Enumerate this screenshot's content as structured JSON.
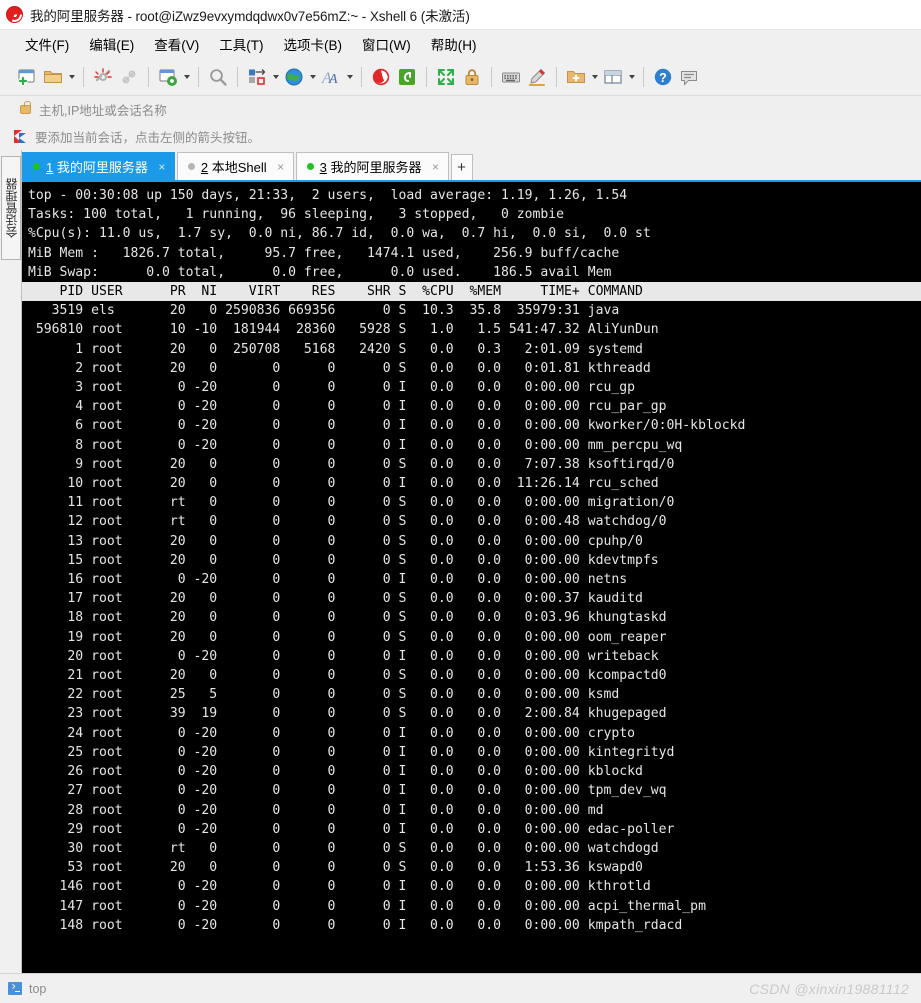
{
  "window": {
    "app_icon": "xshell-logo-icon",
    "title": "我的阿里服务器 - root@iZwz9evxymdqdwx0v7e56mZ:~ - Xshell 6 (未激活)"
  },
  "menubar": {
    "items": [
      {
        "label": "文件(F)",
        "name": "menu-file"
      },
      {
        "label": "编辑(E)",
        "name": "menu-edit"
      },
      {
        "label": "查看(V)",
        "name": "menu-view"
      },
      {
        "label": "工具(T)",
        "name": "menu-tools"
      },
      {
        "label": "选项卡(B)",
        "name": "menu-tabs"
      },
      {
        "label": "窗口(W)",
        "name": "menu-window"
      },
      {
        "label": "帮助(H)",
        "name": "menu-help"
      }
    ]
  },
  "toolbar": {
    "buttons": [
      {
        "icon": "new-session-icon",
        "caret": false
      },
      {
        "icon": "open-folder-icon",
        "caret": true
      },
      {
        "sep": true
      },
      {
        "icon": "disconnect-icon",
        "caret": false
      },
      {
        "icon": "reconnect-icon",
        "caret": false
      },
      {
        "sep": true
      },
      {
        "icon": "session-properties-icon",
        "caret": true
      },
      {
        "sep": true
      },
      {
        "icon": "find-icon",
        "caret": false
      },
      {
        "sep": true
      },
      {
        "icon": "transfer-icon",
        "caret": true
      },
      {
        "icon": "globe-icon",
        "caret": true
      },
      {
        "icon": "font-icon",
        "caret": true
      },
      {
        "sep": true
      },
      {
        "icon": "xshell-red-icon",
        "caret": false
      },
      {
        "icon": "xftp-green-icon",
        "caret": false
      },
      {
        "sep": true
      },
      {
        "icon": "fullscreen-icon",
        "caret": false
      },
      {
        "icon": "lock-icon",
        "caret": false
      },
      {
        "sep": true
      },
      {
        "icon": "keyboard-icon",
        "caret": false
      },
      {
        "icon": "highlight-pen-icon",
        "caret": false
      },
      {
        "sep": true
      },
      {
        "icon": "add-folder-icon",
        "caret": true
      },
      {
        "icon": "split-layout-icon",
        "caret": true
      },
      {
        "sep": true
      },
      {
        "icon": "help-icon",
        "caret": false
      },
      {
        "icon": "chat-icon",
        "caret": false
      }
    ]
  },
  "address": {
    "icon": "lock-icon",
    "placeholder": "主机,IP地址或会话名称",
    "value": ""
  },
  "hint": {
    "icon": "red-flag-icon",
    "text": "要添加当前会话，点击左侧的箭头按钮。"
  },
  "sidebar": {
    "items": [
      {
        "label": "会话管理器",
        "name": "sidebar-session-manager"
      }
    ]
  },
  "tabs": {
    "items": [
      {
        "num": "1",
        "label": "我的阿里服务器",
        "state": "connected",
        "active": true,
        "close": "×"
      },
      {
        "num": "2",
        "label": "本地Shell",
        "state": "idle",
        "active": false,
        "close": "×"
      },
      {
        "num": "3",
        "label": "我的阿里服务器",
        "state": "connected",
        "active": false,
        "close": "×"
      }
    ],
    "add_label": "+"
  },
  "terminal": {
    "summary_lines": [
      "top - 00:30:08 up 150 days, 21:33,  2 users,  load average: 1.19, 1.26, 1.54",
      "Tasks: 100 total,   1 running,  96 sleeping,   3 stopped,   0 zombie",
      "%Cpu(s): 11.0 us,  1.7 sy,  0.0 ni, 86.7 id,  0.0 wa,  0.7 hi,  0.0 si,  0.0 st",
      "MiB Mem :   1826.7 total,     95.7 free,   1474.1 used,    256.9 buff/cache",
      "MiB Swap:      0.0 total,      0.0 free,      0.0 used.    186.5 avail Mem"
    ],
    "blank_line": "",
    "header": "    PID USER      PR  NI    VIRT    RES    SHR S  %CPU  %MEM     TIME+ COMMAND",
    "rows": [
      "   3519 els       20   0 2590836 669356      0 S  10.3  35.8  35979:31 java",
      " 596810 root      10 -10  181944  28360   5928 S   1.0   1.5 541:47.32 AliYunDun",
      "      1 root      20   0  250708   5168   2420 S   0.0   0.3   2:01.09 systemd",
      "      2 root      20   0       0      0      0 S   0.0   0.0   0:01.81 kthreadd",
      "      3 root       0 -20       0      0      0 I   0.0   0.0   0:00.00 rcu_gp",
      "      4 root       0 -20       0      0      0 I   0.0   0.0   0:00.00 rcu_par_gp",
      "      6 root       0 -20       0      0      0 I   0.0   0.0   0:00.00 kworker/0:0H-kblockd",
      "      8 root       0 -20       0      0      0 I   0.0   0.0   0:00.00 mm_percpu_wq",
      "      9 root      20   0       0      0      0 S   0.0   0.0   7:07.38 ksoftirqd/0",
      "     10 root      20   0       0      0      0 I   0.0   0.0  11:26.14 rcu_sched",
      "     11 root      rt   0       0      0      0 S   0.0   0.0   0:00.00 migration/0",
      "     12 root      rt   0       0      0      0 S   0.0   0.0   0:00.48 watchdog/0",
      "     13 root      20   0       0      0      0 S   0.0   0.0   0:00.00 cpuhp/0",
      "     15 root      20   0       0      0      0 S   0.0   0.0   0:00.00 kdevtmpfs",
      "     16 root       0 -20       0      0      0 I   0.0   0.0   0:00.00 netns",
      "     17 root      20   0       0      0      0 S   0.0   0.0   0:00.37 kauditd",
      "     18 root      20   0       0      0      0 S   0.0   0.0   0:03.96 khungtaskd",
      "     19 root      20   0       0      0      0 S   0.0   0.0   0:00.00 oom_reaper",
      "     20 root       0 -20       0      0      0 I   0.0   0.0   0:00.00 writeback",
      "     21 root      20   0       0      0      0 S   0.0   0.0   0:00.00 kcompactd0",
      "     22 root      25   5       0      0      0 S   0.0   0.0   0:00.00 ksmd",
      "     23 root      39  19       0      0      0 S   0.0   0.0   2:00.84 khugepaged",
      "     24 root       0 -20       0      0      0 I   0.0   0.0   0:00.00 crypto",
      "     25 root       0 -20       0      0      0 I   0.0   0.0   0:00.00 kintegrityd",
      "     26 root       0 -20       0      0      0 I   0.0   0.0   0:00.00 kblockd",
      "     27 root       0 -20       0      0      0 I   0.0   0.0   0:00.00 tpm_dev_wq",
      "     28 root       0 -20       0      0      0 I   0.0   0.0   0:00.00 md",
      "     29 root       0 -20       0      0      0 I   0.0   0.0   0:00.00 edac-poller",
      "     30 root      rt   0       0      0      0 S   0.0   0.0   0:00.00 watchdogd",
      "     53 root      20   0       0      0      0 S   0.0   0.0   1:53.36 kswapd0",
      "    146 root       0 -20       0      0      0 I   0.0   0.0   0:00.00 kthrotld",
      "    147 root       0 -20       0      0      0 I   0.0   0.0   0:00.00 acpi_thermal_pm",
      "    148 root       0 -20       0      0      0 I   0.0   0.0   0:00.00 kmpath_rdacd"
    ]
  },
  "statusbar": {
    "icon": "terminal-prompt-icon",
    "text": "top",
    "watermark": "CSDN @xinxin19881112"
  },
  "colors": {
    "accent": "#1a9ae8",
    "terminal_bg": "#000000",
    "terminal_fg": "#e6e6e6",
    "header_row_bg": "#e8e8e8",
    "chrome_bg": "#f0f0f0",
    "connected_dot": "#1fc21f",
    "idle_dot": "#b5b5b5"
  }
}
